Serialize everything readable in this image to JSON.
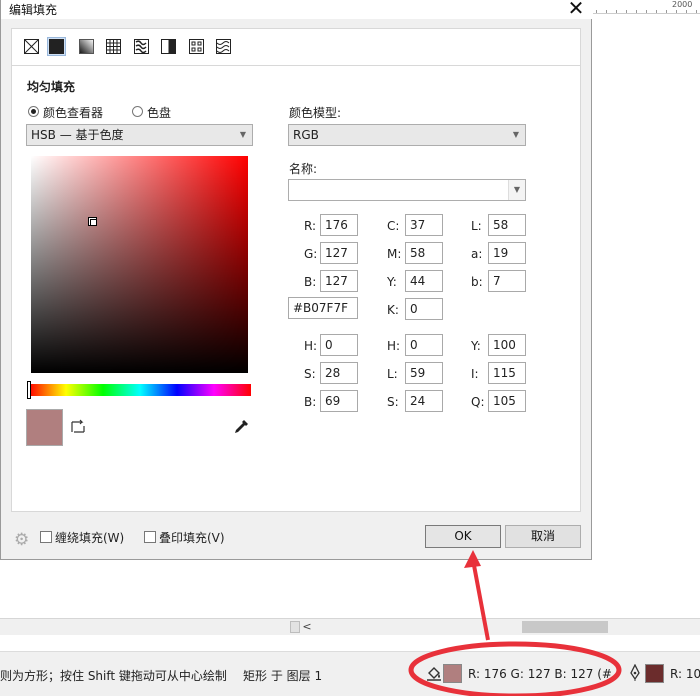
{
  "app": {
    "ruler_label": "2000",
    "scroll_left_arrow": "<"
  },
  "dialog": {
    "title": "编辑填充",
    "close_glyph": "✕",
    "section_title": "均匀填充",
    "mode_options": [
      {
        "label": "颜色查看器",
        "selected": true
      },
      {
        "label": "色盘",
        "selected": false
      }
    ],
    "viewer_dropdown": "HSB — 基于色度",
    "color_model_label": "颜色模型:",
    "color_model_value": "RGB",
    "name_label": "名称:",
    "name_value": "",
    "current_color": "#B07F7F",
    "rgb": {
      "R": "176",
      "G": "127",
      "B": "127"
    },
    "cmyk": {
      "C": "37",
      "M": "58",
      "Y": "44",
      "K": "0"
    },
    "lab": {
      "L": "58",
      "a": "19",
      "b": "7"
    },
    "hex_value": "#B07F7F",
    "hsb": {
      "H": "0",
      "S": "28",
      "B": "69"
    },
    "hls": {
      "H": "0",
      "L": "59",
      "S": "24"
    },
    "yiq": {
      "Y": "100",
      "I": "115",
      "Q": "105"
    },
    "field_labels": {
      "R": "R:",
      "G": "G:",
      "B": "B:",
      "C": "C:",
      "M": "M:",
      "Y": "Y:",
      "K": "K:",
      "L": "L:",
      "a": "a:",
      "b": "b:",
      "H": "H:",
      "S": "S:",
      "Bv": "B:",
      "H2": "H:",
      "L2": "L:",
      "S2": "S:",
      "Yq": "Y:",
      "I": "I:",
      "Q": "Q:"
    },
    "wrap_fill_label": "缠绕填充(W)",
    "overprint_fill_label": "叠印填充(V)",
    "ok_label": "OK",
    "cancel_label": "取消",
    "fill_type_icons": [
      "no-fill-icon",
      "uniform-fill-icon",
      "fountain-fill-icon",
      "vector-pattern-icon",
      "bitmap-pattern-icon",
      "two-color-pattern-icon",
      "texture-fill-icon",
      "postscript-fill-icon"
    ]
  },
  "statusbar": {
    "hint": "则为方形；按住 Shift 键拖动可从中心绘制",
    "object_info": "矩形 于 图层 1",
    "fill_readout": "R:   176 G:   127 B:   127 (#",
    "outline_readout": "R: 10",
    "fill_color": "#B07F7F",
    "outline_color": "#6B2C2C"
  },
  "colors": {
    "annotation_red": "#E8313A"
  }
}
